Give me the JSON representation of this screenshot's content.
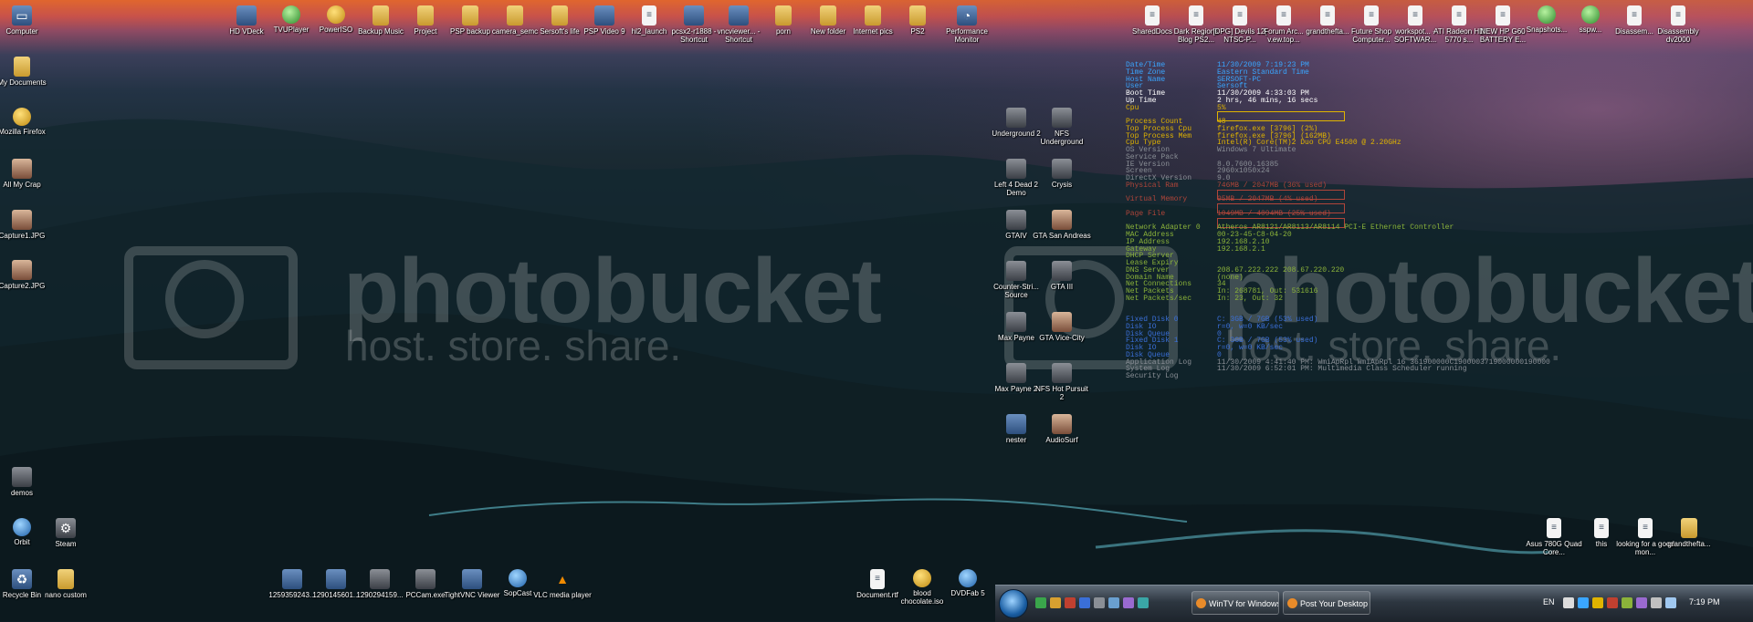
{
  "wallpaper": {
    "watermark_word": "photobucket",
    "watermark_sub": "host. store. share."
  },
  "desktop_left_icons": [
    {
      "label": "Computer",
      "icon": "computer-icon"
    },
    {
      "label": "My Documents",
      "icon": "folder-icon"
    },
    {
      "label": "Mozilla Firefox",
      "icon": "firefox-icon"
    },
    {
      "label": "All My Crap",
      "icon": "folder-icon"
    },
    {
      "label": "Capture1.JPG",
      "icon": "image-icon"
    },
    {
      "label": "Capture2.JPG",
      "icon": "image-icon"
    },
    {
      "label": "demos",
      "icon": "folder-icon"
    },
    {
      "label": "Orbit",
      "icon": "orbit-icon"
    },
    {
      "label": "Steam",
      "icon": "steam-icon"
    },
    {
      "label": "Recycle Bin",
      "icon": "recycle-bin-icon"
    },
    {
      "label": "nano custom",
      "icon": "folder-icon"
    }
  ],
  "desktop_top_icons": [
    {
      "label": "HD VDeck",
      "icon": "app-icon"
    },
    {
      "label": "TVUPlayer",
      "icon": "app-icon"
    },
    {
      "label": "PowerISO",
      "icon": "disc-icon"
    },
    {
      "label": "Backup Music",
      "icon": "folder-icon"
    },
    {
      "label": "Project",
      "icon": "folder-icon"
    },
    {
      "label": "PSP backup",
      "icon": "folder-icon"
    },
    {
      "label": "camera_semc",
      "icon": "folder-icon"
    },
    {
      "label": "Sersoft's life",
      "icon": "folder-icon"
    },
    {
      "label": "PSP Video 9",
      "icon": "app-icon"
    },
    {
      "label": "hl2_launch",
      "icon": "document-icon"
    },
    {
      "label": "pcsx2-r1888 - Shortcut",
      "icon": "app-icon"
    },
    {
      "label": "vncviewer... - Shortcut",
      "icon": "app-icon"
    },
    {
      "label": "porn",
      "icon": "folder-icon"
    },
    {
      "label": "New folder",
      "icon": "folder-icon"
    },
    {
      "label": "Internet pics",
      "icon": "folder-icon"
    },
    {
      "label": "PS2",
      "icon": "folder-icon"
    },
    {
      "label": "Performance Monitor",
      "icon": "monitor-icon"
    }
  ],
  "desktop_top_right_icons": [
    {
      "label": "SharedDocs",
      "icon": "document-icon"
    },
    {
      "label": "Dark Regions Blog PS2...",
      "icon": "document-icon"
    },
    {
      "label": "[DPG] Devils 12[ NTSC-P...",
      "icon": "document-icon"
    },
    {
      "label": "Forum Arc... v.ew.top...",
      "icon": "document-icon"
    },
    {
      "label": "grandthefta...",
      "icon": "document-icon"
    },
    {
      "label": "Future Shop Computer...",
      "icon": "document-icon"
    },
    {
      "label": "workspot... - SOFTWAR...",
      "icon": "document-icon"
    },
    {
      "label": "ATI Radeon HD 5770 s...",
      "icon": "document-icon"
    },
    {
      "label": "NEW HP G60 BATTERY E...",
      "icon": "document-icon"
    },
    {
      "label": "Snapshots...",
      "icon": "globe-icon"
    },
    {
      "label": "sspw...",
      "icon": "globe-icon"
    },
    {
      "label": "Disassem...",
      "icon": "document-icon"
    },
    {
      "label": "Disassembly dv2000",
      "icon": "document-icon"
    }
  ],
  "desktop_middle_icons": [
    {
      "label": "Underground 2",
      "icon": "game-icon"
    },
    {
      "label": "NFS Underground",
      "icon": "game-icon"
    },
    {
      "label": "Left 4 Dead 2 Demo",
      "icon": "game-icon"
    },
    {
      "label": "Crysis",
      "icon": "game-icon"
    },
    {
      "label": "GTAIV",
      "icon": "game-icon"
    },
    {
      "label": "GTA San Andreas",
      "icon": "game-icon"
    },
    {
      "label": "Counter-Stri... Source",
      "icon": "game-icon"
    },
    {
      "label": "GTA III",
      "icon": "game-icon"
    },
    {
      "label": "Max Payne",
      "icon": "game-icon"
    },
    {
      "label": "GTA Vice-City",
      "icon": "game-icon"
    },
    {
      "label": "Max Payne 2",
      "icon": "game-icon"
    },
    {
      "label": "NFS Hot Pursuit 2",
      "icon": "game-icon"
    },
    {
      "label": "nester",
      "icon": "app-icon"
    },
    {
      "label": "AudioSurf",
      "icon": "game-icon"
    }
  ],
  "desktop_bottom_icons": [
    {
      "label": "1259359243...",
      "icon": "image-icon"
    },
    {
      "label": "1290145601...",
      "icon": "image-icon"
    },
    {
      "label": "1290294159...",
      "icon": "image-icon"
    },
    {
      "label": "PCCam.exe",
      "icon": "camera-icon"
    },
    {
      "label": "TightVNC Viewer",
      "icon": "app-icon"
    },
    {
      "label": "SopCast",
      "icon": "app-icon"
    },
    {
      "label": "VLC media player",
      "icon": "vlc-icon"
    }
  ],
  "desktop_bottom_right_icons": [
    {
      "label": "Document.rtf",
      "icon": "document-icon"
    },
    {
      "label": "blood chocolate.iso",
      "icon": "disc-icon"
    },
    {
      "label": "DVDFab 5",
      "icon": "app-icon"
    },
    {
      "label": "Asus 780G Quad Core...",
      "icon": "document-icon"
    },
    {
      "label": "this",
      "icon": "document-icon"
    },
    {
      "label": "looking for a good mon...",
      "icon": "document-icon"
    },
    {
      "label": "grandthefta...",
      "icon": "folder-icon"
    }
  ],
  "system_info": {
    "rows": [
      {
        "label": "Date/Time",
        "value": "11/30/2009 7:19:23 PM",
        "color": "#3aa6ff"
      },
      {
        "label": "Time Zone",
        "value": "Eastern Standard Time",
        "color": "#3aa6ff"
      },
      {
        "label": "Host Name",
        "value": "SERSOFT-PC",
        "color": "#3aa6ff"
      },
      {
        "label": "User",
        "value": "Sersoft",
        "color": "#3aa6ff"
      },
      {
        "label": "Boot Time",
        "value": "11/30/2009 4:33:03 PM",
        "color": "#ffffff"
      },
      {
        "label": "Up Time",
        "value": "2 hrs, 46 mins, 16 secs",
        "color": "#ffffff"
      },
      {
        "label": "Cpu",
        "value": "5%",
        "color": "#e0b400",
        "bar": true
      },
      {
        "label": "",
        "value": "",
        "color": "#e0b400"
      },
      {
        "label": "Process Count",
        "value": "48",
        "color": "#e0b400"
      },
      {
        "label": "Top Process Cpu",
        "value": "firefox.exe [3796] (2%)",
        "color": "#e0b400"
      },
      {
        "label": "Top Process Mem",
        "value": "firefox.exe [3796] (162MB)",
        "color": "#e0b400"
      },
      {
        "label": "Cpu Type",
        "value": "Intel(R) Core(TM)2 Duo CPU     E4500  @ 2.20GHz",
        "color": "#e0b400"
      },
      {
        "label": "OS Version",
        "value": "Windows 7 Ultimate",
        "color": "#8a8f96"
      },
      {
        "label": "Service Pack",
        "value": "",
        "color": "#8a8f96"
      },
      {
        "label": "IE Version",
        "value": "8.0.7600.16385",
        "color": "#8a8f96"
      },
      {
        "label": "Screen",
        "value": "2960x1050x24",
        "color": "#8a8f96"
      },
      {
        "label": "DirectX Version",
        "value": "9.0",
        "color": "#8a8f96"
      },
      {
        "label": "Physical Ram",
        "value": "746MB / 2047MB (36% used)",
        "color": "#b0453a",
        "bar": true
      },
      {
        "label": "",
        "value": "",
        "color": "#b0453a"
      },
      {
        "label": "Virtual Memory",
        "value": "95MB / 2047MB (4% used)",
        "color": "#b0453a",
        "bar": true
      },
      {
        "label": "",
        "value": "",
        "color": "#b0453a"
      },
      {
        "label": "Page File",
        "value": "1049MB / 4094MB (25% used)",
        "color": "#b0453a",
        "bar": true
      },
      {
        "label": "",
        "value": "",
        "color": "#b0453a"
      },
      {
        "label": "Network Adapter 0",
        "value": "Atheros AR8121/AR8113/AR8114 PCI-E Ethernet Controller",
        "color": "#8bb33a"
      },
      {
        "label": "  MAC Address",
        "value": "00-23-45-C8-04-20",
        "color": "#8bb33a"
      },
      {
        "label": "  IP Address",
        "value": "192.168.2.10",
        "color": "#8bb33a"
      },
      {
        "label": "  Gateway",
        "value": "192.168.2.1",
        "color": "#8bb33a"
      },
      {
        "label": "  DHCP Server",
        "value": "",
        "color": "#8bb33a"
      },
      {
        "label": "  Lease Expiry",
        "value": "",
        "color": "#8bb33a"
      },
      {
        "label": "DNS Server",
        "value": "208.67.222.222 208.67.220.220",
        "color": "#8bb33a"
      },
      {
        "label": "Domain Name",
        "value": "(none)",
        "color": "#8bb33a"
      },
      {
        "label": "Net Connections",
        "value": "34",
        "color": "#8bb33a"
      },
      {
        "label": "Net Packets",
        "value": "In: 268781, Out: 531616",
        "color": "#8bb33a"
      },
      {
        "label": "Net Packets/sec",
        "value": "In: 23, Out: 32",
        "color": "#8bb33a"
      },
      {
        "label": "",
        "value": "",
        "color": "#8bb33a"
      },
      {
        "label": "",
        "value": "",
        "color": "#8bb33a"
      },
      {
        "label": "Fixed Disk 0",
        "value": "C: 3GB / 7GB (53% used)",
        "color": "#3a6fd8"
      },
      {
        "label": "  Disk IO",
        "value": "r=0, w=0 KB/sec",
        "color": "#3a6fd8"
      },
      {
        "label": "  Disk Queue",
        "value": "0",
        "color": "#3a6fd8"
      },
      {
        "label": "Fixed Disk 1",
        "value": "C: 3GB / 7GB (53% used)",
        "color": "#3a6fd8"
      },
      {
        "label": "  Disk IO",
        "value": "r=0, w=0 KB/sec",
        "color": "#3a6fd8"
      },
      {
        "label": "  Disk Queue",
        "value": "0",
        "color": "#3a6fd8"
      },
      {
        "label": "Application Log",
        "value": "11/30/2009 4:41:40 PM: WmiApRpl WmiApRpl 16 361900000C1900003719000000190000",
        "color": "#8a8f96"
      },
      {
        "label": "System Log",
        "value": "11/30/2009 6:52:01 PM: Multimedia Class Scheduler running",
        "color": "#8a8f96"
      },
      {
        "label": "Security Log",
        "value": "",
        "color": "#8a8f96"
      }
    ]
  },
  "taskbar": {
    "buttons": [
      {
        "label": "WinTV for Windows..."
      },
      {
        "label": "Post Your Desktop - ..."
      }
    ],
    "language": "EN",
    "clock": "7:19 PM"
  }
}
